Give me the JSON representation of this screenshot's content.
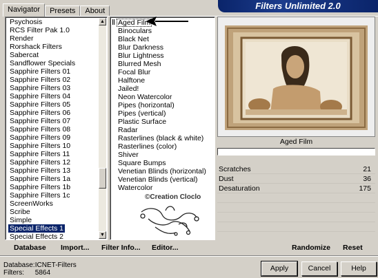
{
  "app": {
    "title": "Filters Unlimited 2.0"
  },
  "tabs": [
    "Navigator",
    "Presets",
    "About"
  ],
  "categories": [
    "Psychosis",
    "RCS Filter Pak 1.0",
    "Render",
    "Rorshack Filters",
    "Sabercat",
    "Sandflower Specials",
    "Sapphire Filters 01",
    "Sapphire Filters 02",
    "Sapphire Filters 03",
    "Sapphire Filters 04",
    "Sapphire Filters 05",
    "Sapphire Filters 06",
    "Sapphire Filters 07",
    "Sapphire Filters 08",
    "Sapphire Filters 09",
    "Sapphire Filters 10",
    "Sapphire Filters 11",
    "Sapphire Filters 12",
    "Sapphire Filters 13",
    "Sapphire Filters 1a",
    "Sapphire Filters 1b",
    "Sapphire Filters 1c",
    "ScreenWorks",
    "Scribe",
    "Simple",
    "Special Effects 1",
    "Special Effects 2"
  ],
  "selected_category": "Special Effects 1",
  "filters": [
    "Aged Film",
    "Binoculars",
    "Black Net",
    "Blur Darkness",
    "Blur Lightness",
    "Blurred Mesh",
    "Focal Blur",
    "Halftone",
    "Jailed!",
    "Neon Watercolor",
    "Pipes (horizontal)",
    "Pipes (vertical)",
    "Plastic Surface",
    "Radar",
    "Rasterlines (black & white)",
    "Rasterlines (color)",
    "Shiver",
    "Square Bumps",
    "Venetian Blinds (horizontal)",
    "Venetian Blinds (vertical)",
    "Watercolor"
  ],
  "selected_filter": "Aged Film",
  "watermark": "©Creation Cloclo",
  "preview": {
    "filter_name": "Aged Film"
  },
  "params": [
    {
      "label": "Scratches",
      "value": "21"
    },
    {
      "label": "Dust",
      "value": "36"
    },
    {
      "label": "Desaturation",
      "value": "175"
    }
  ],
  "toolbar": {
    "database": "Database",
    "import": "Import...",
    "filter_info": "Filter Info...",
    "editor": "Editor...",
    "randomize": "Randomize",
    "reset": "Reset"
  },
  "info": {
    "database_label": "Database:",
    "database_value": "ICNET-Filters",
    "filters_label": "Filters:",
    "filters_value": "5864"
  },
  "buttons": {
    "apply": "Apply",
    "cancel": "Cancel",
    "help": "Help"
  },
  "colors": {
    "accent": "#0a246a",
    "sepia": "#c8b08a"
  }
}
